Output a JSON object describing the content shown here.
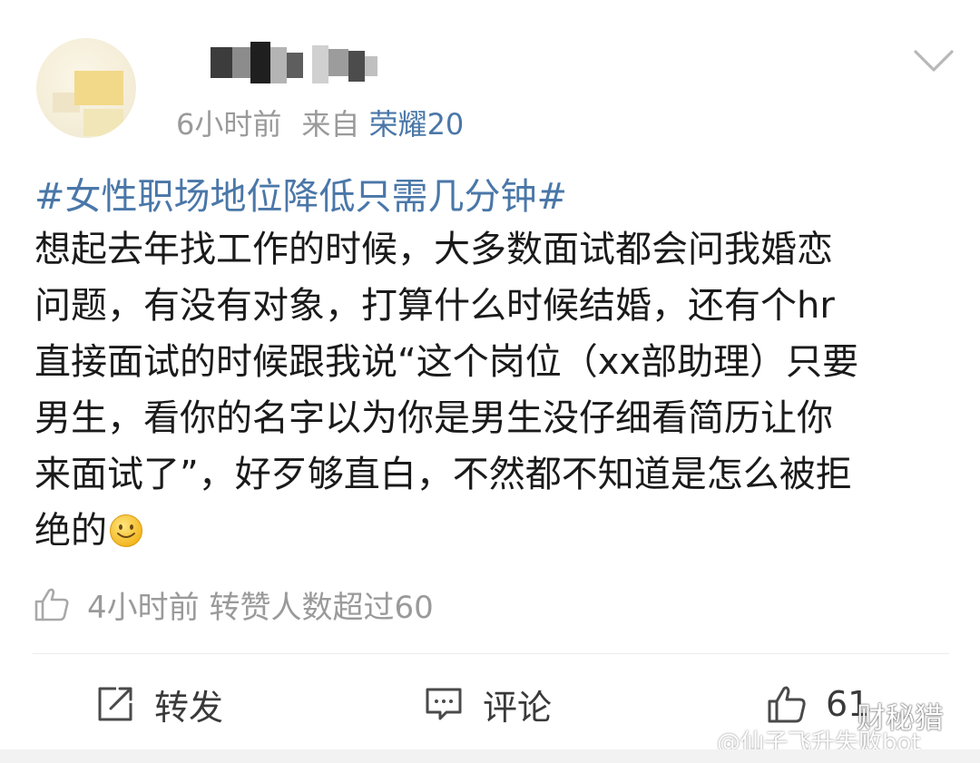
{
  "header": {
    "time_ago": "6小时前",
    "source_prefix": "来自",
    "source_device": "荣耀20"
  },
  "post": {
    "hashtag": "#女性职场地位降低只需几分钟#",
    "lines": [
      "想起去年找工作的时候，大多数面试都会问我婚恋",
      "问题，有没有对象，打算什么时候结婚，还有个hr",
      "直接面试的时候跟我说“这个岗位（xx部助理）只要",
      "男生，看你的名字以为你是男生没仔细看简历让你",
      "来面试了”，好歹够直白，不然都不知道是怎么被拒",
      "绝的"
    ],
    "emoji": "smile-emoji"
  },
  "summary": {
    "text": "4小时前 转赞人数超过60"
  },
  "actions": {
    "repost_label": "转发",
    "comment_label": "评论",
    "like_count": "61"
  },
  "watermarks": {
    "site": "财秘猎",
    "account": "@仙子飞升失败bot"
  },
  "colors": {
    "link": "#4a77a8",
    "meta": "#9a9a9a",
    "text": "#1a1a1a"
  }
}
